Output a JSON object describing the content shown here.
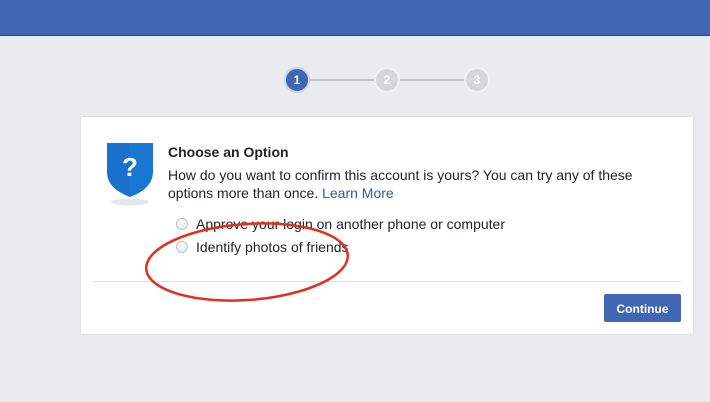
{
  "stepper": {
    "steps": [
      "1",
      "2",
      "3"
    ]
  },
  "card": {
    "title": "Choose an Option",
    "description": "How do you want to confirm this account is yours? You can try any of these options more than once.",
    "learn_more": "Learn More",
    "shield_symbol": "?",
    "options": [
      "Approve your login on another phone or computer",
      "Identify photos of friends"
    ],
    "continue_label": "Continue"
  },
  "colors": {
    "brand_blue": "#4267b2",
    "annotation_red": "#e0301e",
    "shield_blue": "#1877d2"
  }
}
